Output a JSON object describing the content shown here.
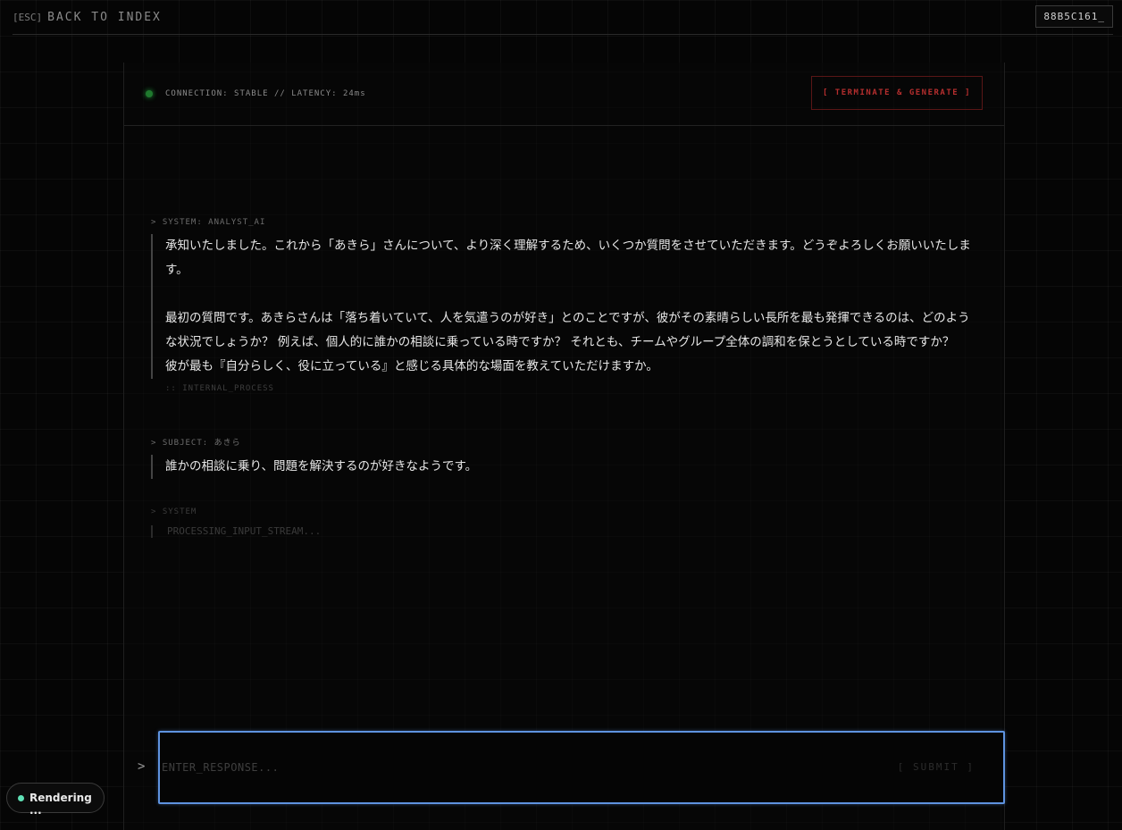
{
  "topbar": {
    "esc_label": "[ESC]",
    "back_label": "BACK TO INDEX",
    "session_id": "88B5C161_"
  },
  "header": {
    "connection_status": "CONNECTION: STABLE // LATENCY: 24ms",
    "terminate_label": "[ TERMINATE & GENERATE ]",
    "status_color": "#1f7a2e"
  },
  "messages": [
    {
      "label": "> SYSTEM: ANALYST_AI",
      "paragraphs": [
        "承知いたしました。これから「あきら」さんについて、より深く理解するため、いくつか質問をさせていただきます。どうぞよろしくお願いいたしま\nす。",
        "最初の質問です。あきらさんは「落ち着いていて、人を気遣うのが好き」とのことですが、彼がその素晴らしい長所を最も発揮できるのは、どのよう\nな状況でしょうか？ 例えば、個人的に誰かの相談に乗っている時ですか？ それとも、チームやグループ全体の調和を保とうとしている時ですか？\n彼が最も『自分らしく、役に立っている』と感じる具体的な場面を教えていただけますか。"
      ],
      "process": ":: INTERNAL_PROCESS"
    },
    {
      "label": "> SUBJECT: あきら",
      "text": "誰かの相談に乗り、問題を解決するのが好きなようです。"
    },
    {
      "label": "> SYSTEM",
      "text": "PROCESSING_INPUT_STREAM..."
    }
  ],
  "input": {
    "prompt": ">",
    "placeholder": "ENTER_RESPONSE...",
    "value": "",
    "submit_label": "[ SUBMIT ]"
  },
  "status_pill": {
    "label": "Rendering ...",
    "accent": "#5fe0b5"
  }
}
